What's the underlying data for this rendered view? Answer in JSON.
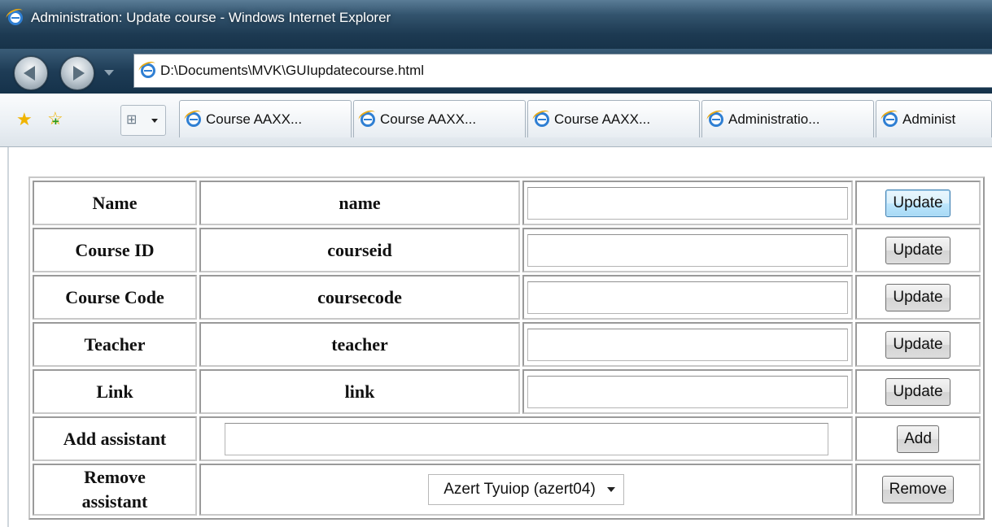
{
  "window": {
    "title": "Administration: Update course - Windows Internet Explorer",
    "address": "D:\\Documents\\MVK\\GUIupdatecourse.html"
  },
  "tabs": [
    {
      "label": "Course AAXX..."
    },
    {
      "label": "Course AAXX..."
    },
    {
      "label": "Course AAXX..."
    },
    {
      "label": "Administratio..."
    },
    {
      "label": "Administ"
    }
  ],
  "form": {
    "rows": [
      {
        "label": "Name",
        "value": "name",
        "button": "Update"
      },
      {
        "label": "Course ID",
        "value": "courseid",
        "button": "Update"
      },
      {
        "label": "Course Code",
        "value": "coursecode",
        "button": "Update"
      },
      {
        "label": "Teacher",
        "value": "teacher",
        "button": "Update"
      },
      {
        "label": "Link",
        "value": "link",
        "button": "Update"
      }
    ],
    "add_assistant": {
      "label": "Add assistant",
      "button": "Add"
    },
    "remove_assistant": {
      "label_line1": "Remove",
      "label_line2": "assistant",
      "selected": "Azert Tyuiop (azert04)",
      "button": "Remove"
    }
  }
}
